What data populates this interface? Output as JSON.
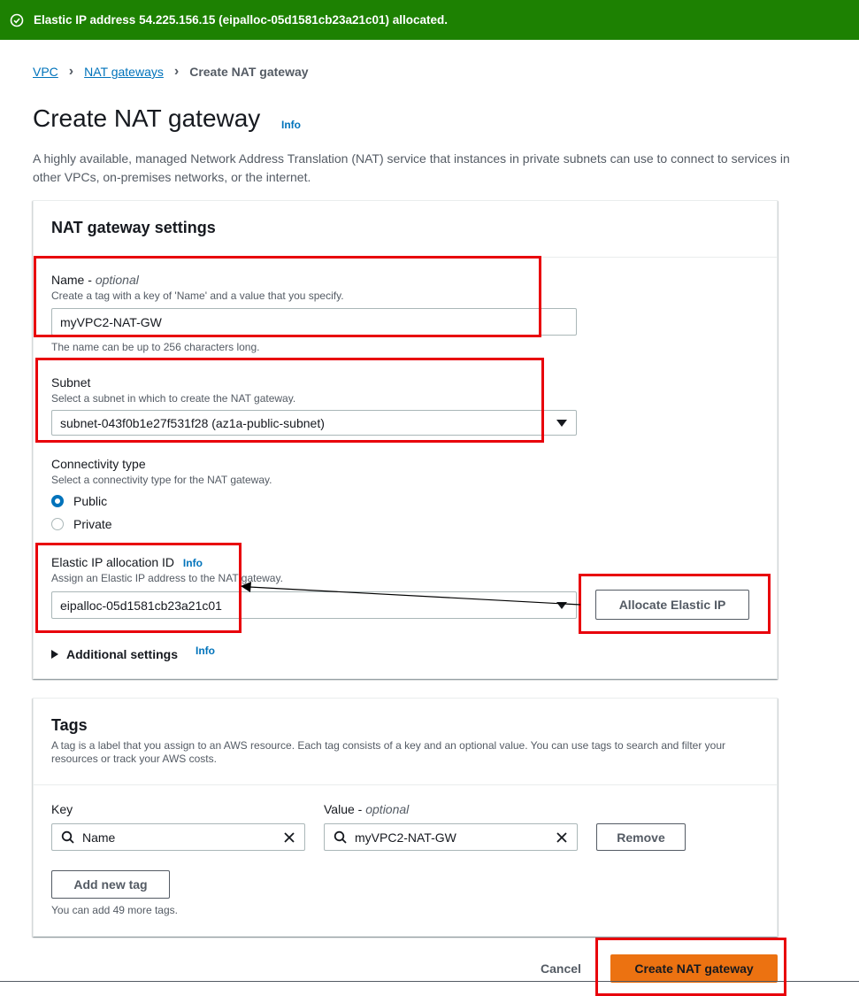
{
  "flash": {
    "message": "Elastic IP address 54.225.156.15 (eipalloc-05d1581cb23a21c01) allocated."
  },
  "breadcrumb": {
    "items": [
      "VPC",
      "NAT gateways"
    ],
    "current": "Create NAT gateway"
  },
  "page": {
    "title": "Create NAT gateway",
    "info": "Info",
    "description": "A highly available, managed Network Address Translation (NAT) service that instances in private subnets can use to connect to services in other VPCs, on-premises networks, or the internet."
  },
  "settings": {
    "header": "NAT gateway settings",
    "name": {
      "label": "Name",
      "label_suffix": "optional",
      "hint": "Create a tag with a key of 'Name' and a value that you specify.",
      "value": "myVPC2-NAT-GW",
      "constraint": "The name can be up to 256 characters long."
    },
    "subnet": {
      "label": "Subnet",
      "hint": "Select a subnet in which to create the NAT gateway.",
      "value": "subnet-043f0b1e27f531f28 (az1a-public-subnet)"
    },
    "connectivity": {
      "label": "Connectivity type",
      "hint": "Select a connectivity type for the NAT gateway.",
      "options": [
        "Public",
        "Private"
      ],
      "selected": "Public"
    },
    "elastic_ip": {
      "label": "Elastic IP allocation ID",
      "info": "Info",
      "hint": "Assign an Elastic IP address to the NAT gateway.",
      "value": "eipalloc-05d1581cb23a21c01",
      "allocate_button": "Allocate Elastic IP"
    },
    "additional": {
      "label": "Additional settings",
      "info": "Info"
    }
  },
  "tags": {
    "header": "Tags",
    "description": "A tag is a label that you assign to an AWS resource. Each tag consists of a key and an optional value. You can use tags to search and filter your resources or track your AWS costs.",
    "key_label": "Key",
    "value_label": "Value",
    "value_label_suffix": "optional",
    "key_value": "Name",
    "value_value": "myVPC2-NAT-GW",
    "remove_button": "Remove",
    "add_button": "Add new tag",
    "limit_note": "You can add 49 more tags."
  },
  "footer": {
    "cancel": "Cancel",
    "submit": "Create NAT gateway"
  },
  "colors": {
    "success": "#1d8102",
    "link": "#0073bb",
    "primary": "#ec7211",
    "highlight": "#e8000b"
  }
}
